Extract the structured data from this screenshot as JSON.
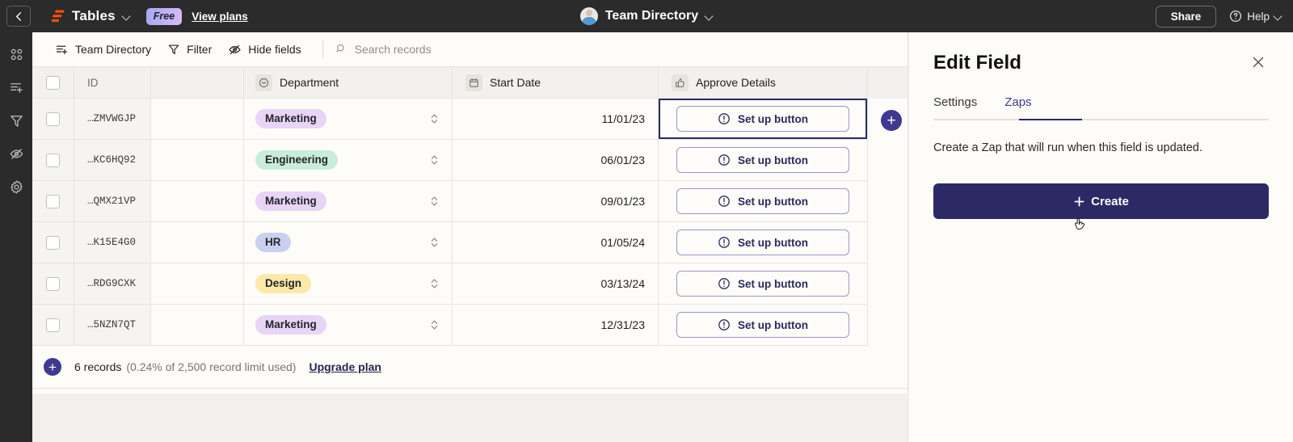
{
  "topbar": {
    "back_icon": "arrow-left-icon",
    "brand_name": "Tables",
    "brand_caret": "chevron-down-icon",
    "plan_badge": "Free",
    "view_plans": "View plans",
    "doc_title": "Team Directory",
    "doc_caret": "chevron-down-icon",
    "share_label": "Share",
    "help_label": "Help",
    "help_icon": "question-circle-icon"
  },
  "rail": {
    "items": [
      {
        "name": "apps-grid-icon",
        "label": "Apps"
      },
      {
        "name": "add-view-icon",
        "label": "Add view"
      },
      {
        "name": "filter-icon",
        "label": "Filter"
      },
      {
        "name": "hide-fields-icon",
        "label": "Hide fields"
      },
      {
        "name": "settings-gear-icon",
        "label": "Settings"
      }
    ]
  },
  "toolbar": {
    "view_name": "Team Directory",
    "view_icon": "view-list-add-icon",
    "filter_label": "Filter",
    "filter_icon": "funnel-icon",
    "hide_fields_label": "Hide fields",
    "hide_fields_icon": "eye-slash-icon",
    "search_placeholder": "Search records",
    "search_icon": "search-icon"
  },
  "grid": {
    "add_field_icon": "plus-circle-icon",
    "columns": [
      {
        "key": "check",
        "label": "",
        "icon": "checkbox-icon"
      },
      {
        "key": "id",
        "label": "ID",
        "icon": ""
      },
      {
        "key": "blank",
        "label": "",
        "icon": ""
      },
      {
        "key": "department",
        "label": "Department",
        "icon": "single-select-icon"
      },
      {
        "key": "start_date",
        "label": "Start Date",
        "icon": "calendar-icon"
      },
      {
        "key": "approve_details",
        "label": "Approve Details",
        "icon": "thumbs-up-icon"
      }
    ],
    "button_label": "Set up button",
    "button_icon": "exclamation-circle-icon",
    "stepper_icon": "chevron-up-down-icon",
    "rows": [
      {
        "id": "…ZMVWGJP",
        "department": "Marketing",
        "tag_bg": "#e7d4f7",
        "start_date": "11/01/23",
        "approve": "Set up button",
        "selected": true
      },
      {
        "id": "…KC6HQ92",
        "department": "Engineering",
        "tag_bg": "#c9ecdc",
        "start_date": "06/01/23",
        "approve": "Set up button",
        "selected": false
      },
      {
        "id": "…QMX21VP",
        "department": "Marketing",
        "tag_bg": "#e7d4f7",
        "start_date": "09/01/23",
        "approve": "Set up button",
        "selected": false
      },
      {
        "id": "…K15E4G0",
        "department": "HR",
        "tag_bg": "#c9d0ef",
        "start_date": "01/05/24",
        "approve": "Set up button",
        "selected": false
      },
      {
        "id": "…RDG9CXK",
        "department": "Design",
        "tag_bg": "#fae9a8",
        "start_date": "03/13/24",
        "approve": "Set up button",
        "selected": false
      },
      {
        "id": "…5NZN7QT",
        "department": "Marketing",
        "tag_bg": "#e7d4f7",
        "start_date": "12/31/23",
        "approve": "Set up button",
        "selected": false
      }
    ]
  },
  "footer": {
    "add_record_icon": "plus-circle-icon",
    "record_count": "6 records",
    "limit_text": "(0.24% of 2,500 record limit used)",
    "upgrade_link": "Upgrade plan"
  },
  "panel": {
    "title": "Edit Field",
    "close_icon": "close-icon",
    "tabs": [
      {
        "label": "Settings",
        "active": false
      },
      {
        "label": "Zaps",
        "active": true
      }
    ],
    "description": "Create a Zap that will run when this field is updated.",
    "create_label": "Create",
    "create_icon": "plus-icon"
  },
  "colors": {
    "topbar_bg": "#2b2b2b",
    "accent": "#2b2a66",
    "accent_bright": "#3f3a8f",
    "sheet_bg": "#fdfcf8",
    "canvas_bg": "#f1f0ee"
  }
}
